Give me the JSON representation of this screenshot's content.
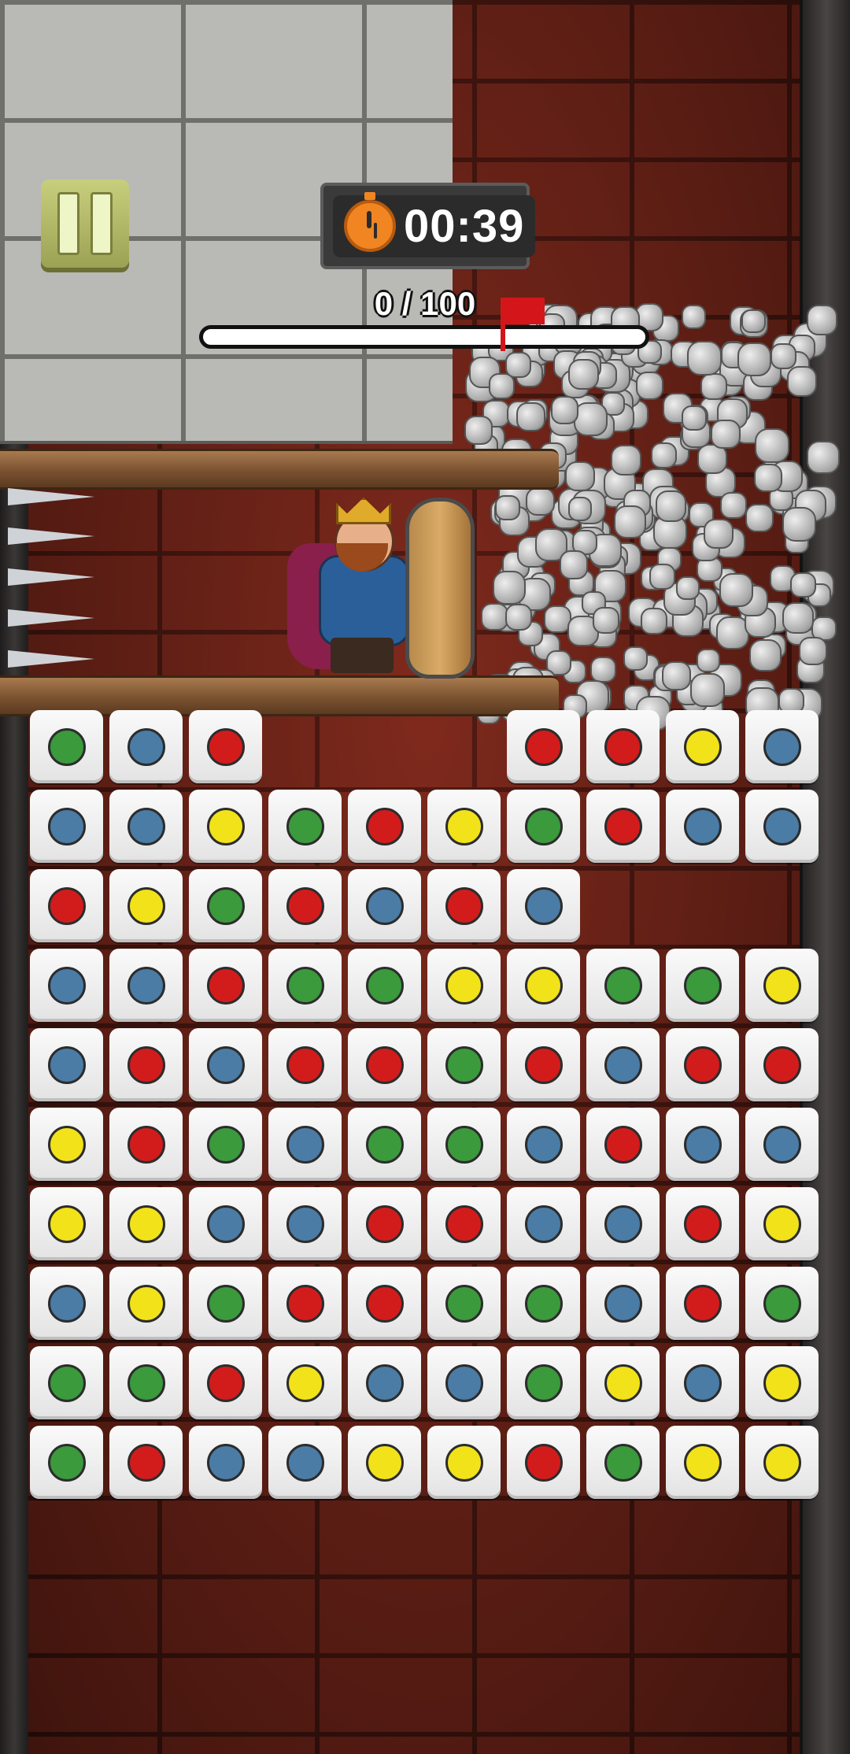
{
  "hud": {
    "timer": "00:39",
    "progress_label": "0 / 100",
    "progress_value": 0,
    "progress_max": 100
  },
  "colors": {
    "green": "#3a9a3c",
    "blue": "#4a7ca6",
    "red": "#d21c1c",
    "yellow": "#f2e21a"
  },
  "board": {
    "rows": [
      [
        "green",
        "blue",
        "red",
        null,
        null,
        null,
        "red",
        "red",
        "yellow",
        "blue"
      ],
      [
        "blue",
        "blue",
        "yellow",
        "green",
        "red",
        "yellow",
        "green",
        "red",
        "blue",
        "blue"
      ],
      [
        "red",
        "yellow",
        "green",
        "red",
        "blue",
        "red",
        "blue",
        null,
        null,
        null
      ],
      [
        "blue",
        "blue",
        "red",
        "green",
        "green",
        "yellow",
        "yellow",
        "green",
        "green",
        "yellow"
      ],
      [
        "blue",
        "red",
        "blue",
        "red",
        "red",
        "green",
        "red",
        "blue",
        "red",
        "red"
      ],
      [
        "yellow",
        "red",
        "green",
        "blue",
        "green",
        "green",
        "blue",
        "red",
        "blue",
        "blue"
      ],
      [
        "yellow",
        "yellow",
        "blue",
        "blue",
        "red",
        "red",
        "blue",
        "blue",
        "red",
        "yellow"
      ],
      [
        "blue",
        "yellow",
        "green",
        "red",
        "red",
        "green",
        "green",
        "blue",
        "red",
        "green"
      ],
      [
        "green",
        "green",
        "red",
        "yellow",
        "blue",
        "blue",
        "green",
        "yellow",
        "blue",
        "yellow"
      ],
      [
        "green",
        "red",
        "blue",
        "blue",
        "yellow",
        "yellow",
        "red",
        "green",
        "yellow",
        "yellow"
      ]
    ]
  }
}
